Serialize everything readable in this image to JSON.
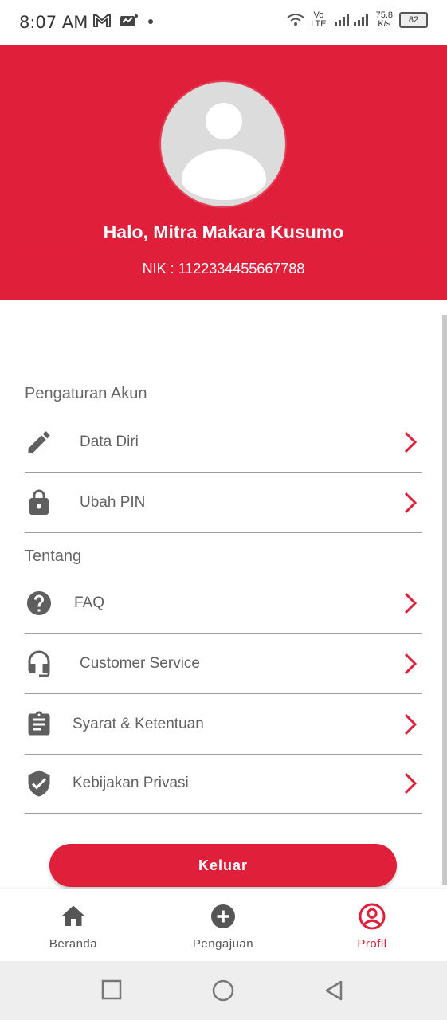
{
  "status_bar": {
    "time": "8:07 AM",
    "net_top": "Vo",
    "net_bottom": "LTE",
    "speed_value": "75.8",
    "speed_unit": "K/s",
    "battery": "82"
  },
  "profile": {
    "greeting": "Halo, Mitra Makara Kusumo",
    "nik": "NIK : 1122334455667788"
  },
  "sections": {
    "account_title": "Pengaturan Akun",
    "about_title": "Tentang"
  },
  "menu": {
    "data_diri": "Data Diri",
    "ubah_pin": "Ubah PIN",
    "faq": "FAQ",
    "customer_service": "Customer Service",
    "syarat": "Syarat & Ketentuan",
    "kebijakan": "Kebijakan Privasi"
  },
  "logout_label": "Keluar",
  "bottom_nav": {
    "home": "Beranda",
    "submission": "Pengajuan",
    "profile": "Profil",
    "active": "profile"
  },
  "colors": {
    "primary": "#e01f3a",
    "text_gray": "#616161",
    "icon_gray": "#5f5f5f"
  }
}
